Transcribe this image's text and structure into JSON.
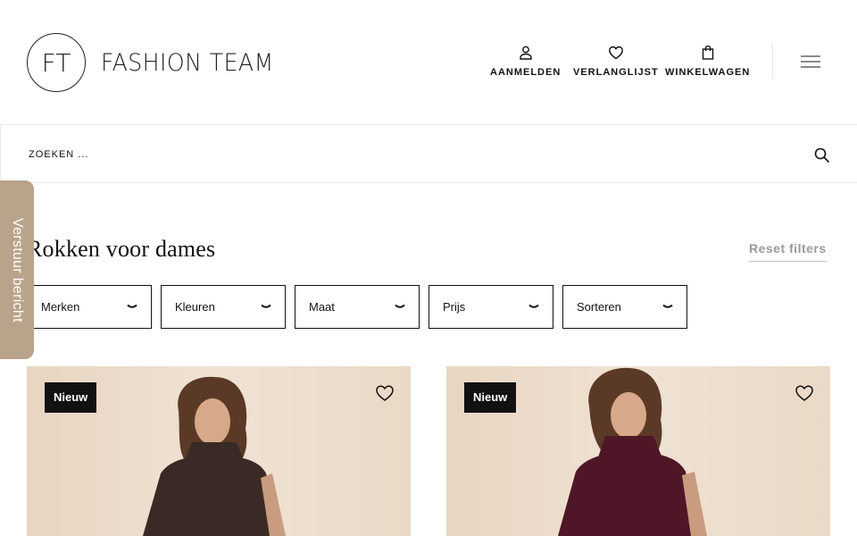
{
  "brand": {
    "monogram": "FT",
    "name": "FASHION TEAM"
  },
  "nav": {
    "login": "AANMELDEN",
    "wishlist": "VERLANGLIJST",
    "cart": "WINKELWAGEN"
  },
  "search": {
    "placeholder": "ZOEKEN ..."
  },
  "side_tab": {
    "label": "Verstuur bericht"
  },
  "page": {
    "title": "Rokken voor dames",
    "reset": "Reset filters"
  },
  "filters": [
    "Merken",
    "Kleuren",
    "Maat",
    "Prijs",
    "Sorteren"
  ],
  "products": [
    {
      "badge": "Nieuw",
      "garment_color": "#3a2a25"
    },
    {
      "badge": "Nieuw",
      "garment_color": "#4e1626"
    }
  ],
  "colors": {
    "side_tab": "#b9a38b",
    "badge_bg": "#111111"
  }
}
